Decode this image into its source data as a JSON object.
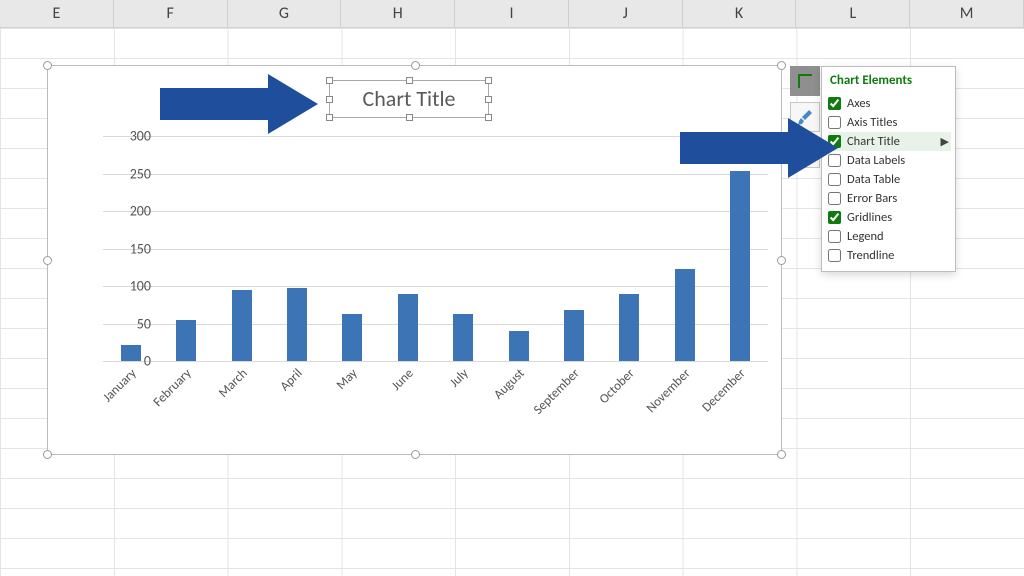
{
  "columns": [
    "E",
    "F",
    "G",
    "H",
    "I",
    "J",
    "K",
    "L",
    "M"
  ],
  "chart": {
    "title": "Chart Title"
  },
  "chart_elements": {
    "heading": "Chart Elements",
    "items": [
      {
        "label": "Axes",
        "checked": true
      },
      {
        "label": "Axis Titles",
        "checked": false
      },
      {
        "label": "Chart Title",
        "checked": true,
        "highlight": true,
        "has_sub": true
      },
      {
        "label": "Data Labels",
        "checked": false
      },
      {
        "label": "Data Table",
        "checked": false
      },
      {
        "label": "Error Bars",
        "checked": false
      },
      {
        "label": "Gridlines",
        "checked": true
      },
      {
        "label": "Legend",
        "checked": false
      },
      {
        "label": "Trendline",
        "checked": false
      }
    ]
  },
  "chart_data": {
    "type": "bar",
    "title": "Chart Title",
    "categories": [
      "January",
      "February",
      "March",
      "April",
      "May",
      "June",
      "July",
      "August",
      "September",
      "October",
      "November",
      "December"
    ],
    "values": [
      22,
      55,
      95,
      98,
      63,
      90,
      63,
      40,
      68,
      90,
      123,
      253
    ],
    "ylabel": "",
    "xlabel": "",
    "ylim": [
      0,
      300
    ],
    "yticks": [
      0,
      50,
      100,
      150,
      200,
      250,
      300
    ]
  }
}
